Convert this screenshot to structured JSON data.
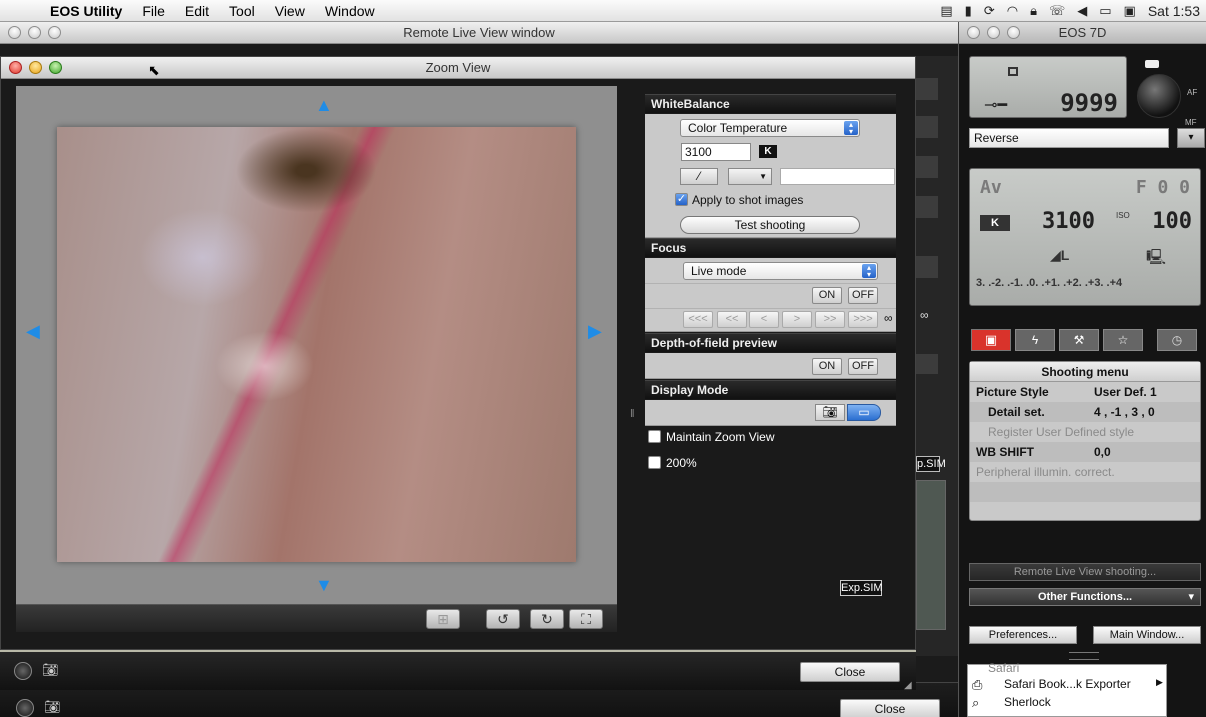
{
  "menubar": {
    "app_name": "EOS Utility",
    "items": [
      "File",
      "Edit",
      "Tool",
      "View",
      "Window"
    ],
    "clock": "Sat 1:53"
  },
  "remote_window": {
    "title": "Remote Live View window",
    "close_label": "Close",
    "expsim_label": "Exp.SIM",
    "expsim_label_right": "p.SIM",
    "infinity": "∞"
  },
  "zoom_view": {
    "title": "Zoom View",
    "close_label": "Close",
    "expsim_label": "Exp.SIM",
    "white_balance": {
      "heading": "WhiteBalance",
      "mode": "Color Temperature",
      "kelvin": "3100",
      "kelvin_unit": "K",
      "apply_label": "Apply to shot images",
      "apply_checked": true,
      "test_label": "Test shooting"
    },
    "focus": {
      "heading": "Focus",
      "mode": "Live mode",
      "on_label": "ON",
      "off_label": "OFF",
      "step_buttons": [
        "<<<",
        "<<",
        "<",
        ">",
        ">>",
        ">>>"
      ],
      "infinity": "∞"
    },
    "dof": {
      "heading": "Depth-of-field preview",
      "on_label": "ON",
      "off_label": "OFF"
    },
    "display_mode": {
      "heading": "Display Mode"
    },
    "maintain_zoom_label": "Maintain Zoom View",
    "zoom200_label": "200%"
  },
  "eos_panel": {
    "title": "EOS 7D",
    "shots_remaining": "9999",
    "af_label": "AF",
    "mf_label": "MF",
    "reverse_label": "Reverse",
    "mode": "Av",
    "aperture": "F 0 0",
    "wb_badge": "K",
    "kelvin": "3100",
    "iso_label": "ISO",
    "iso": "100",
    "quality": "◢L",
    "exposure_scale": "3. .-2. .-1. .0. .+1. .+2. .+3. .+4",
    "tabs": [
      "camera-tab",
      "flash-tab",
      "tools-tab",
      "star-tab",
      "timer-tab"
    ],
    "shooting_menu": {
      "title": "Shooting menu",
      "rows": [
        {
          "label": "Picture Style",
          "value": "User Def. 1"
        },
        {
          "label": "Detail set.",
          "value": "4 , -1 , 3 , 0"
        },
        {
          "label": "Register User Defined style",
          "value": ""
        },
        {
          "label": "WB SHIFT",
          "value": "0,0"
        },
        {
          "label": "Peripheral illumin. correct.",
          "value": ""
        }
      ]
    },
    "remote_live_label": "Remote Live View shooting...",
    "other_functions_label": "Other Functions...",
    "preferences_label": "Preferences...",
    "main_window_label": "Main Window...",
    "list_items": [
      "Safari",
      "Safari Book...k Exporter",
      "Sherlock"
    ]
  },
  "colors": {
    "accent_blue": "#1f8ce6",
    "camera_tab_red": "#d9332b"
  }
}
